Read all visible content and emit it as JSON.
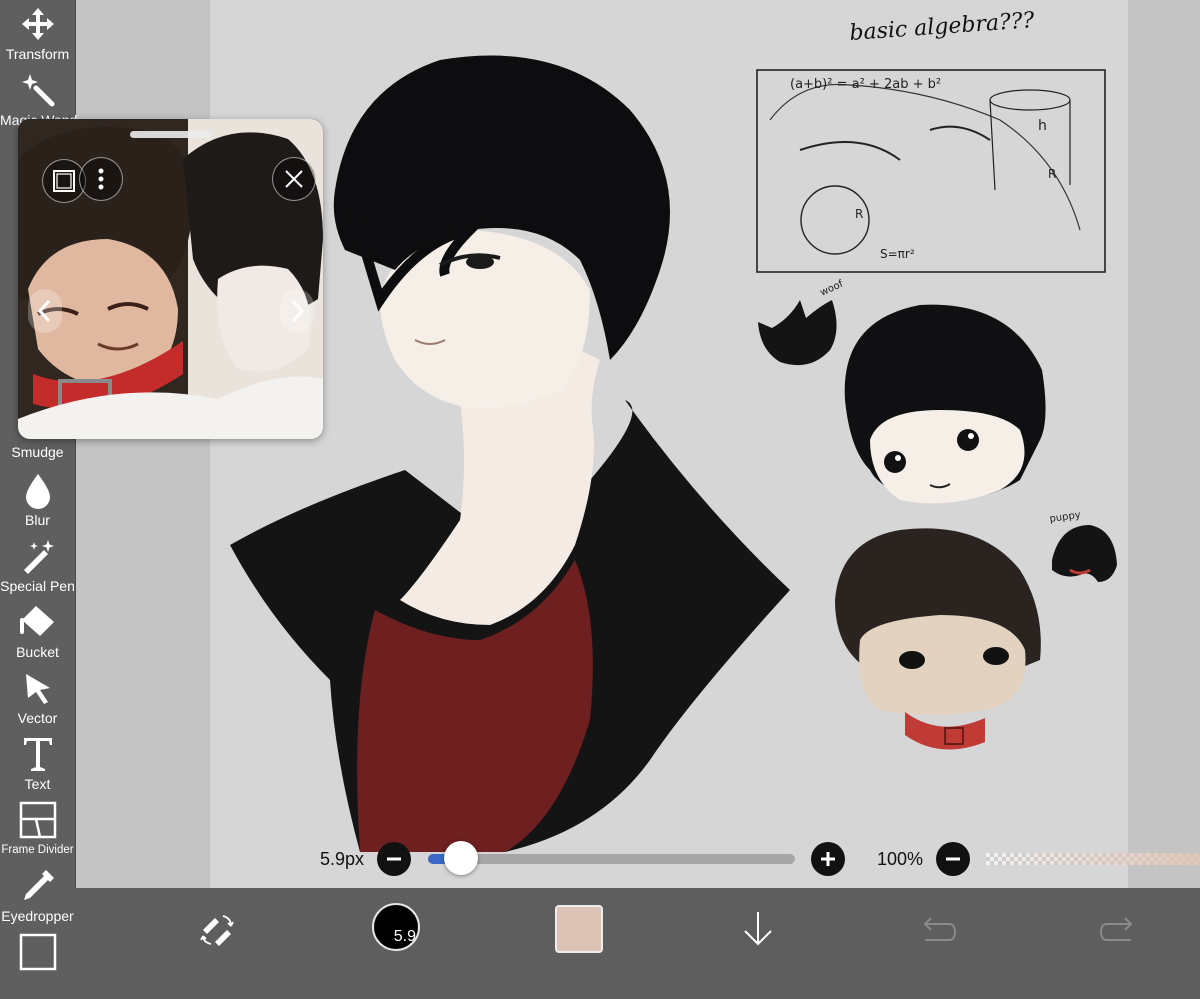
{
  "toolbar": {
    "tools": [
      {
        "id": "transform",
        "label": "Transform",
        "icon": "transform-icon"
      },
      {
        "id": "magic-wand",
        "label": "Magic Wand",
        "icon": "magic-wand-icon"
      },
      {
        "id": "smudge",
        "label": "Smudge",
        "icon": "smudge-icon"
      },
      {
        "id": "blur",
        "label": "Blur",
        "icon": "blur-icon"
      },
      {
        "id": "special-pen",
        "label": "Special Pen",
        "icon": "special-pen-icon"
      },
      {
        "id": "bucket",
        "label": "Bucket",
        "icon": "bucket-icon"
      },
      {
        "id": "vector",
        "label": "Vector",
        "icon": "vector-icon"
      },
      {
        "id": "text",
        "label": "Text",
        "icon": "text-icon"
      },
      {
        "id": "frame-divider",
        "label": "Frame Divider",
        "icon": "frame-divider-icon"
      },
      {
        "id": "eyedropper",
        "label": "Eyedropper",
        "icon": "eyedropper-icon"
      },
      {
        "id": "canvas",
        "label": "",
        "icon": "canvas-icon"
      }
    ]
  },
  "canvas": {
    "sketch_note": "basic algebra???",
    "sketch_formula_1": "(a+b)² = a² + 2ab + b²",
    "sketch_formula_2": "S=πr²",
    "sketch_label_h": "h",
    "sketch_label_r": "R",
    "cat_label": "woof",
    "dog_label": "puppy"
  },
  "brush_controls": {
    "size_label": "5.9px",
    "size_fraction": 0.09,
    "opacity_label": "100%"
  },
  "bottom_bar": {
    "brush_preview_label": "5.9",
    "current_color": "#dcc3b6"
  },
  "colors": {
    "toolbar_bg": "#5f5f5f",
    "accent_blue": "#3b68c9",
    "collar_red": "#c03a36",
    "shirt_red": "#6e1f1f"
  }
}
